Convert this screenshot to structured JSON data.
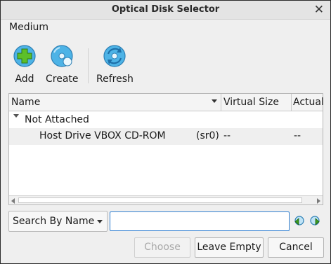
{
  "window": {
    "title": "Optical Disk Selector",
    "close_glyph": "✕"
  },
  "menu": {
    "medium": "Medium"
  },
  "toolbar": {
    "add": {
      "label": "Add",
      "icon": "add-disk-icon"
    },
    "create": {
      "label": "Create",
      "icon": "create-disk-icon"
    },
    "refresh": {
      "label": "Refresh",
      "icon": "refresh-icon"
    }
  },
  "table": {
    "columns": [
      "Name",
      "Virtual Size",
      "Actual"
    ],
    "groups": [
      {
        "label": "Not Attached",
        "items": [
          {
            "name": "Host Drive VBOX CD-ROM",
            "device": "(sr0)",
            "virtual_size": "--",
            "actual_size": "--"
          }
        ]
      }
    ]
  },
  "search": {
    "mode": "Search By Name",
    "value": "",
    "prev_icon": "search-backward-icon",
    "next_icon": "search-forward-icon"
  },
  "buttons": {
    "choose": "Choose",
    "leave_empty": "Leave Empty",
    "cancel": "Cancel"
  },
  "colors": {
    "accent": "#2f7fd1",
    "icon_green": "#4fa82b",
    "icon_blue": "#3fa0de"
  }
}
